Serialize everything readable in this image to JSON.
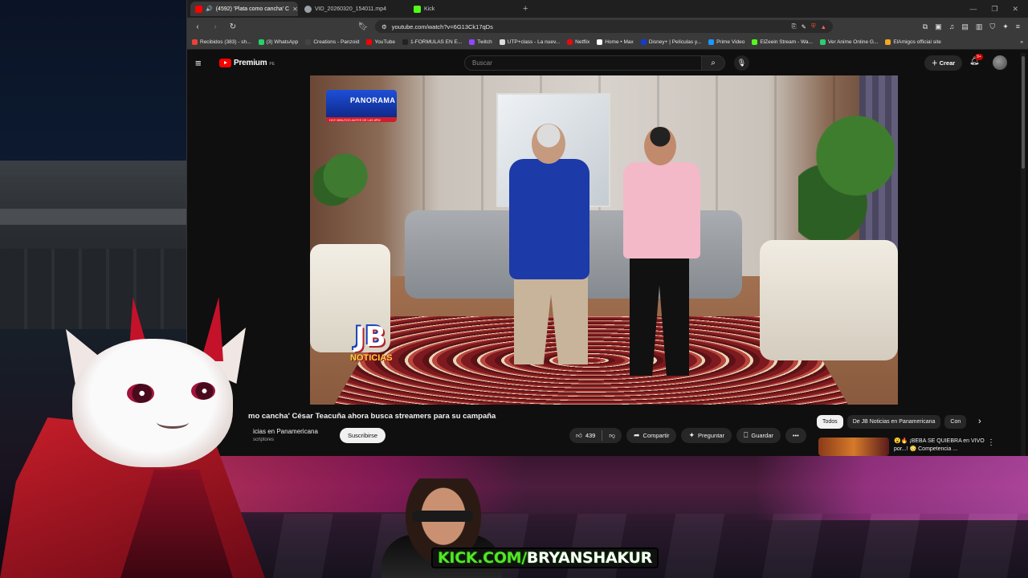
{
  "browser": {
    "tabs": [
      {
        "label": "(4592) 'Plata como cancha' C",
        "favicon_color": "#ff0000",
        "active": true
      },
      {
        "label": "VID_20260320_154011.mp4",
        "favicon_color": "#9aa0a6",
        "active": false
      },
      {
        "label": "Kick",
        "favicon_color": "#53fc18",
        "active": false
      }
    ],
    "new_tab": "+",
    "url": "youtube.com/watch?v=6G13Ck17qDs",
    "bookmarks": [
      {
        "label": "Recibidos (383) - sh...",
        "color": "#ea4335"
      },
      {
        "label": "(3) WhatsApp",
        "color": "#25d366"
      },
      {
        "label": "Creations - Panzoid",
        "color": "#444444"
      },
      {
        "label": "YouTube",
        "color": "#ff0000"
      },
      {
        "label": "1-FORMULAS EN E...",
        "color": "#222222"
      },
      {
        "label": "Twitch",
        "color": "#9146ff"
      },
      {
        "label": "UTP+class - La nuev...",
        "color": "#dddddd"
      },
      {
        "label": "Netflix",
        "color": "#e50914"
      },
      {
        "label": "Home • Max",
        "color": "#ffffff"
      },
      {
        "label": "Disney+ | Películas y...",
        "color": "#113ccf"
      },
      {
        "label": "Prime Video",
        "color": "#1a98ff"
      },
      {
        "label": "ElZeein Stream - Wa...",
        "color": "#53fc18"
      },
      {
        "label": "Ver Anime Online G...",
        "color": "#2ecc71"
      },
      {
        "label": "ElAmigos official site",
        "color": "#f5a623"
      }
    ]
  },
  "youtube": {
    "logo_text": "Premium",
    "logo_region": "PE",
    "search_placeholder": "Buscar",
    "create_label": "Crear",
    "notification_count": "9+",
    "player": {
      "badge_channel": "PANORAMA",
      "badge_sub": "HOY MINUTOS ANTES DE LAS 8PM",
      "watermark_big": "JB",
      "watermark_small": "NOTICIAS"
    },
    "video_title": "mo cancha' César Teacuña ahora busca streamers para su campaña",
    "channel_name": "icias en Panamericana",
    "subscribers": "scriptores",
    "subscribe_label": "Suscribirse",
    "likes": "439",
    "share_label": "Compartir",
    "ask_label": "Preguntar",
    "save_label": "Guardar",
    "chips": [
      "Todos",
      "De JB Noticias en Panamericana",
      "Con"
    ],
    "recommendation_title": "😮🔥 ¡BEBA SE QUIEBRA en VIVO por...! 😳 Competencia ..."
  },
  "overlay": {
    "kick_domain": "KICK.COM/",
    "kick_user": "BRYANSHAKUR"
  },
  "colors": {
    "yt_red": "#ff0000",
    "kick_green": "#54e625"
  }
}
